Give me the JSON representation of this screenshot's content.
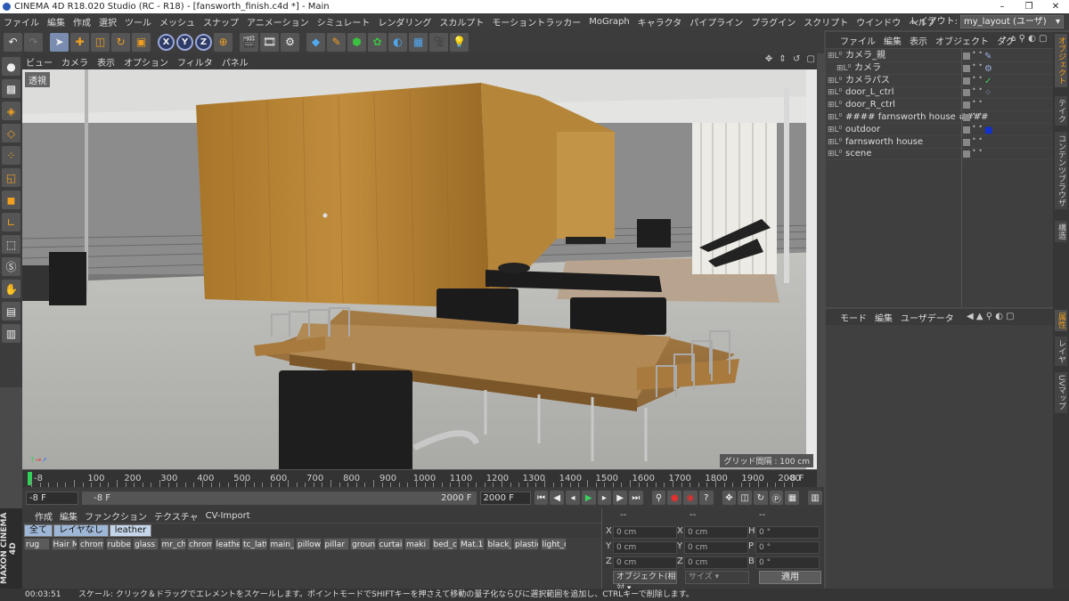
{
  "window": {
    "title": "CINEMA 4D R18.020 Studio (RC - R18) - [fansworth_finish.c4d *] - Main",
    "controls": [
      "–",
      "❐",
      "✕"
    ]
  },
  "menubar": {
    "items": [
      "ファイル",
      "編集",
      "作成",
      "選択",
      "ツール",
      "メッシュ",
      "スナップ",
      "アニメーション",
      "シミュレート",
      "レンダリング",
      "スカルプト",
      "モーショントラッカー",
      "MoGraph",
      "キャラクタ",
      "パイプライン",
      "プラグイン",
      "スクリプト",
      "ウインドウ",
      "ヘルプ"
    ],
    "layout_label": "レイアウト:",
    "layout_value": "my_layout (ユーザ)"
  },
  "toolbar": {
    "icons": [
      "undo-icon",
      "redo-icon",
      "select-arrow-icon",
      "move-icon",
      "scale-icon",
      "rotate-icon",
      "last-tool-icon",
      "x-axis-icon",
      "y-axis-icon",
      "z-axis-icon",
      "coord-system-icon",
      "render-view-icon",
      "render-picture-viewer-icon",
      "render-settings-icon",
      "cube-icon",
      "pen-icon",
      "subdivide-icon",
      "mograph-icon",
      "deformer-icon",
      "floor-icon",
      "camera-icon",
      "light-icon"
    ],
    "axis_labels": [
      "X",
      "Y",
      "Z"
    ]
  },
  "viewport": {
    "menu": [
      "ビュー",
      "カメラ",
      "表示",
      "オプション",
      "フィルタ",
      "パネル"
    ],
    "view_label": "透視",
    "grid_label": "グリッド間隔 : 100 cm"
  },
  "timeline": {
    "ticks": [
      "-8",
      "100",
      "200",
      "300",
      "400",
      "500",
      "600",
      "700",
      "800",
      "900",
      "1000",
      "1100",
      "1200",
      "1300",
      "1400",
      "1500",
      "1600",
      "1700",
      "1800",
      "1900",
      "2000",
      "-8 F"
    ],
    "current_frame": "-8 F",
    "start_field": "-8 F",
    "end_field": "2000 F",
    "end_field2": "2000 F"
  },
  "materials": {
    "menu": [
      "作成",
      "編集",
      "ファンクション",
      "テクスチャ",
      "CV-Import"
    ],
    "filters": [
      "全て",
      "レイヤなし",
      "leather"
    ],
    "row1": [
      {
        "name": "rug",
        "color": "#6a5a4a"
      },
      {
        "name": "Hair M",
        "color": "#2a2a2a"
      },
      {
        "name": "chrom",
        "color": "#cfcfcf"
      },
      {
        "name": "rubbe",
        "color": "#1a1a1a"
      },
      {
        "name": "glass",
        "color": "#bfc6cc"
      },
      {
        "name": "mr_ch",
        "color": "#1c1c1c"
      },
      {
        "name": "chrom",
        "color": "#d8d8d8"
      },
      {
        "name": "leathe",
        "color": "#b8842e"
      },
      {
        "name": "tc_latt",
        "color": "#e0e0e0"
      },
      {
        "name": "main_",
        "color": "#d0d0d0"
      },
      {
        "name": "pillow",
        "color": "#2e2e2e"
      },
      {
        "name": "pillar",
        "color": "#f0f0f0"
      },
      {
        "name": "groun",
        "color": "#8a8a8a"
      },
      {
        "name": "curtai",
        "color": "#4a2a24"
      },
      {
        "name": "maki",
        "color": "#111111"
      },
      {
        "name": "bed_c",
        "color": "#3a2a22"
      },
      {
        "name": "Mat.1",
        "color": "#5a3a2a"
      }
    ],
    "row2": [
      {
        "name": "black_",
        "color": "#0a0a0a"
      },
      {
        "name": "plastic",
        "color": "#1e1e1e"
      },
      {
        "name": "light_c",
        "color": "#f4f4f4"
      }
    ]
  },
  "coords": {
    "headers": [
      "--",
      "--",
      "--"
    ],
    "rows": [
      {
        "a": "X",
        "av": "0 cm",
        "b": "X",
        "bv": "0 cm",
        "c": "H",
        "cv": "0 °"
      },
      {
        "a": "Y",
        "av": "0 cm",
        "b": "Y",
        "bv": "0 cm",
        "c": "P",
        "cv": "0 °"
      },
      {
        "a": "Z",
        "av": "0 cm",
        "b": "Z",
        "bv": "0 cm",
        "c": "B",
        "cv": "0 °"
      }
    ],
    "object_mode": "オブジェクト(相対",
    "size_mode": "サイズ",
    "apply": "適用"
  },
  "object_manager": {
    "menu": [
      "ファイル",
      "編集",
      "表示",
      "オブジェクト",
      "タグ"
    ],
    "items": [
      {
        "name": "カメラ_親",
        "indent": 0,
        "tag": "✎"
      },
      {
        "name": "カメラ",
        "indent": 1,
        "tag": "⚙"
      },
      {
        "name": "カメラパス",
        "indent": 0,
        "tag": "✓"
      },
      {
        "name": "door_L_ctrl",
        "indent": 0,
        "tag": "⁘"
      },
      {
        "name": "door_R_ctrl",
        "indent": 0,
        "tag": ""
      },
      {
        "name": "#### farnsworth house ####",
        "indent": 0,
        "tag": ""
      },
      {
        "name": "outdoor",
        "indent": 0,
        "tag": "■"
      },
      {
        "name": "farnsworth house",
        "indent": 0,
        "tag": ""
      },
      {
        "name": "scene",
        "indent": 0,
        "tag": ""
      }
    ]
  },
  "attributes": {
    "menu": [
      "モード",
      "編集",
      "ユーザデータ"
    ]
  },
  "right_tabs": {
    "top": [
      "オブジェクト",
      "テイク",
      "コンテンツブラウザ",
      "構造"
    ],
    "bottom": [
      "属性",
      "レイヤ",
      "UVマップ"
    ]
  },
  "status": {
    "time": "00:03:51",
    "message": "スケール: クリック＆ドラッグでエレメントをスケールします。ポイントモードでSHIFTキーを押さえて移動の量子化ならびに選択範囲を追加し、CTRLキーで削除します。"
  },
  "logo": {
    "text": "MAXON CINEMA 4D"
  },
  "colors": {
    "accent": "#f0a020",
    "playhead": "#33d05a",
    "selection": "#9eb7d6"
  }
}
